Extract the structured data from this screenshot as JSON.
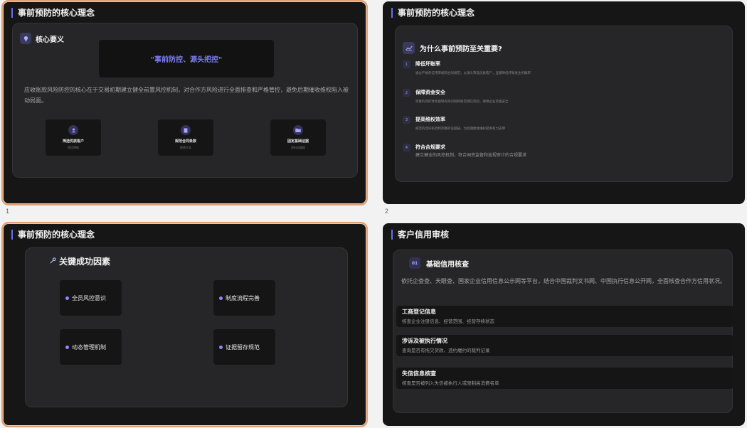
{
  "slide_numbers": [
    "1",
    "2"
  ],
  "slide1": {
    "title": "事前预防的核心理念",
    "section_label": "核心要义",
    "quote": "\"事前防控、源头把控\"",
    "description": "应收账款风险防控的核心在于交易初期建立健全前置风控机制，对合作方风险进行全面排查和严格管控，避免后期催收维权陷入被动局面。",
    "features": [
      {
        "title": "筛选优质客户",
        "subtitle": "资信审核",
        "icon": "user-icon"
      },
      {
        "title": "规范合同条款",
        "subtitle": "权责文本",
        "icon": "document-icon"
      },
      {
        "title": "固定基础证据",
        "subtitle": "资料证据链",
        "icon": "folder-icon"
      }
    ]
  },
  "slide2": {
    "title": "事前预防的核心理念",
    "heading": "为什么事前预防至关重要?",
    "reasons": [
      {
        "num": "1",
        "title": "降低坏账率",
        "desc": "通过严格的信用审核和合同规范，从源头筛选优质客户，显著降低坏账发生的概率"
      },
      {
        "num": "2",
        "title": "保障资金安全",
        "desc": "完善的风控体系能够有效识别和防范潜在风险，保障企业资金安全"
      },
      {
        "num": "3",
        "title": "提高维权效率",
        "desc": "规范的合同条款和完整的证据链，为后期催收维权提供有力支撑"
      },
      {
        "num": "4",
        "title": "符合合规要求",
        "desc": "建立健全的风控机制，符合国资监管和巡视审计的合规要求"
      }
    ]
  },
  "slide3": {
    "title": "事前预防的核心理念",
    "heading": "关键成功因素",
    "factors": [
      "全员风控意识",
      "制度流程完善",
      "动态管理机制",
      "证据留存规范"
    ]
  },
  "slide4": {
    "title": "客户信用审核",
    "badge": "01",
    "heading": "基础信用核查",
    "description": "依托企查查、天眼查、国家企业信用信息公示网等平台，结合中国裁判文书网、中国执行信息公开网，全面核查合作方信用状况。",
    "items": [
      {
        "title": "工商登记信息",
        "desc": "核查企业注册信息、经营范围、经营存续状态"
      },
      {
        "title": "涉诉及被执行情况",
        "desc": "查询是否有拖欠货款、违约履约的裁判记录"
      },
      {
        "title": "失信信息核查",
        "desc": "核查是否被列入失信被执行人或限制高消费名单"
      }
    ]
  },
  "colors": {
    "accent": "#6b6cf0",
    "selection": "#e0a074",
    "slide_bg": "#161616",
    "panel_bg": "#262628"
  }
}
